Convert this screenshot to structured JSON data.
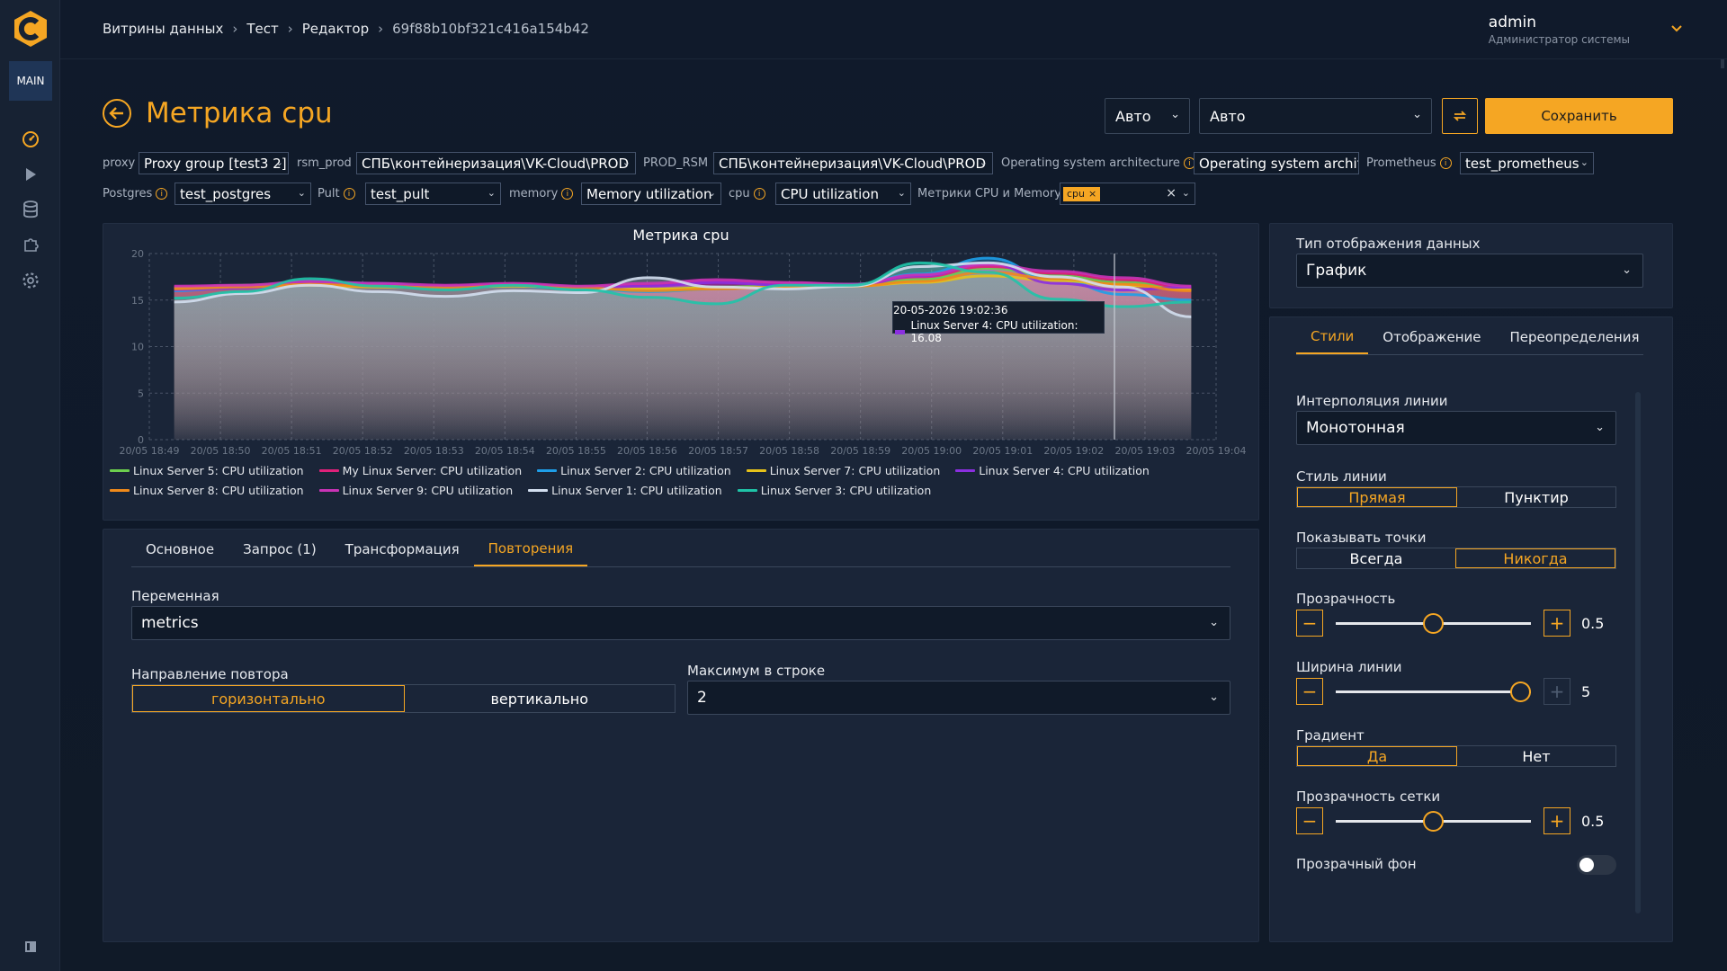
{
  "nav": {
    "main_label": "MAIN"
  },
  "breadcrumb": {
    "items": [
      "Витрины данных",
      "Тест",
      "Редактор"
    ],
    "id": "69f88b10bf321c416a154b42"
  },
  "user": {
    "name": "admin",
    "role": "Администратор системы"
  },
  "page": {
    "title": "Метрика cpu"
  },
  "toolbar": {
    "auto_small": "Авто",
    "auto_wide": "Авто",
    "save_label": "Сохранить"
  },
  "variables": {
    "proxy": {
      "label": "proxy",
      "value": "Proxy group [test3 2]"
    },
    "rsm_prod": {
      "label": "rsm_prod",
      "value": "СПБ\\контейнеризация\\VK-Cloud\\PROD"
    },
    "prod_rsm": {
      "label": "PROD_RSM",
      "value": "СПБ\\контейнеризация\\VK-Cloud\\PROD"
    },
    "os_arch": {
      "label": "Operating system architecture",
      "value": "Operating system archit"
    },
    "prometheus": {
      "label": "Prometheus",
      "value": "test_prometheus"
    },
    "postgres": {
      "label": "Postgres",
      "value": "test_postgres"
    },
    "pult": {
      "label": "Pult",
      "value": "test_pult"
    },
    "memory": {
      "label": "memory",
      "value": "Memory utilization"
    },
    "cpu": {
      "label": "cpu",
      "value": "CPU utilization"
    },
    "cpu_mem": {
      "label": "Метрики CPU и Memory",
      "chip": "cpu"
    }
  },
  "chart_data": {
    "type": "area",
    "title": "Метрика cpu",
    "x": [
      "20/05 18:49",
      "20/05 18:50",
      "20/05 18:51",
      "20/05 18:52",
      "20/05 18:53",
      "20/05 18:54",
      "20/05 18:55",
      "20/05 18:56",
      "20/05 18:57",
      "20/05 18:58",
      "20/05 18:59",
      "20/05 19:00",
      "20/05 19:01",
      "20/05 19:02",
      "20/05 19:03",
      "20/05 19:04"
    ],
    "ylim": [
      0,
      20
    ],
    "yticks": [
      0,
      5,
      10,
      15,
      20
    ],
    "grid": true,
    "legend_position": "bottom",
    "series": [
      {
        "name": "Linux Server 5: CPU utilization",
        "color": "#6ccf4e",
        "values": [
          16.2,
          16.6,
          16.8,
          16.5,
          16.4,
          16.6,
          16.3,
          16.1,
          16.4,
          16.5,
          16.6,
          17.2,
          18.4,
          17.6,
          16.9,
          16.2
        ]
      },
      {
        "name": "My Linux Server: CPU utilization",
        "color": "#e0217a",
        "values": [
          16.4,
          16.5,
          16.8,
          16.6,
          16.5,
          16.7,
          16.4,
          16.6,
          17.0,
          16.8,
          16.7,
          17.5,
          18.6,
          17.9,
          17.2,
          16.3
        ]
      },
      {
        "name": "Linux Server 2: CPU utilization",
        "color": "#1e9ee8",
        "values": [
          16.0,
          16.4,
          17.0,
          16.8,
          16.3,
          16.5,
          16.2,
          15.9,
          16.2,
          16.5,
          16.7,
          17.8,
          19.5,
          17.2,
          15.6,
          15.0
        ]
      },
      {
        "name": "Linux Server 7: CPU utilization",
        "color": "#e6c21a",
        "values": [
          16.3,
          16.5,
          16.6,
          16.4,
          16.4,
          16.5,
          16.4,
          16.2,
          16.3,
          16.4,
          16.5,
          16.9,
          17.6,
          17.1,
          16.6,
          16.1
        ]
      },
      {
        "name": "Linux Server 4: CPU utilization",
        "color": "#8b2fe0",
        "values": [
          16.1,
          16.3,
          16.9,
          16.7,
          16.4,
          16.6,
          16.3,
          16.5,
          16.9,
          16.6,
          16.6,
          17.6,
          18.9,
          16.8,
          16.08,
          16.4
        ]
      },
      {
        "name": "Linux Server 8: CPU utilization",
        "color": "#f08a1a",
        "values": [
          16.2,
          16.4,
          16.7,
          16.5,
          16.3,
          16.6,
          16.3,
          16.0,
          16.2,
          16.4,
          16.5,
          17.0,
          18.0,
          17.3,
          16.7,
          16.0
        ]
      },
      {
        "name": "Linux Server 9: CPU utilization",
        "color": "#c933b6",
        "values": [
          16.5,
          16.6,
          17.0,
          16.8,
          16.6,
          16.8,
          16.5,
          16.8,
          17.2,
          16.9,
          16.7,
          17.7,
          18.8,
          18.1,
          17.4,
          16.5
        ]
      },
      {
        "name": "Linux Server 1: CPU utilization",
        "color": "#d3dff0",
        "values": [
          14.8,
          15.7,
          16.6,
          15.9,
          15.4,
          16.0,
          15.8,
          17.4,
          16.4,
          16.2,
          16.5,
          18.6,
          19.0,
          17.5,
          16.4,
          13.2
        ]
      },
      {
        "name": "Linux Server 3: CPU utilization",
        "color": "#1fc4a8",
        "values": [
          15.2,
          15.9,
          17.3,
          16.5,
          16.1,
          16.6,
          16.1,
          15.3,
          14.6,
          16.6,
          16.6,
          19.0,
          18.0,
          15.1,
          14.3,
          14.8
        ]
      }
    ],
    "tooltip": {
      "time": "20-05-2026 19:02:36",
      "text": "Linux Server 4: CPU utilization: 16.08"
    }
  },
  "editor": {
    "tabs": [
      "Основное",
      "Запрос (1)",
      "Трансформация",
      "Повторения"
    ],
    "active_tab": "Повторения",
    "variable_label": "Переменная",
    "variable_value": "metrics",
    "direction_label": "Направление повтора",
    "direction_options": [
      "горизонтально",
      "вертикально"
    ],
    "direction_selected": "горизонтально",
    "max_label": "Максимум в строке",
    "max_value": "2"
  },
  "settings": {
    "display_type_label": "Тип отображения данных",
    "display_type_value": "График",
    "tabs": [
      "Стили",
      "Отображение",
      "Переопределения"
    ],
    "active_tab": "Стили",
    "interpolation_label": "Интерполяция линии",
    "interpolation_value": "Монотонная",
    "line_style_label": "Стиль линии",
    "line_style_options": [
      "Прямая",
      "Пунктир"
    ],
    "line_style_selected": "Прямая",
    "points_label": "Показывать точки",
    "points_options": [
      "Всегда",
      "Никогда"
    ],
    "points_selected": "Никогда",
    "opacity_label": "Прозрачность",
    "opacity_value": "0.5",
    "opacity_level": 0.5,
    "line_width_label": "Ширина линии",
    "line_width_value": "5",
    "line_width_level": 1.0,
    "gradient_label": "Градиент",
    "gradient_options": [
      "Да",
      "Нет"
    ],
    "gradient_selected": "Да",
    "grid_opacity_label": "Прозрачность сетки",
    "grid_opacity_value": "0.5",
    "grid_opacity_level": 0.5,
    "transparent_bg_label": "Прозрачный фон",
    "transparent_bg_on": false
  },
  "colors": {
    "accent": "#f5a623",
    "panel": "#1a2538",
    "background": "#0f1929"
  }
}
